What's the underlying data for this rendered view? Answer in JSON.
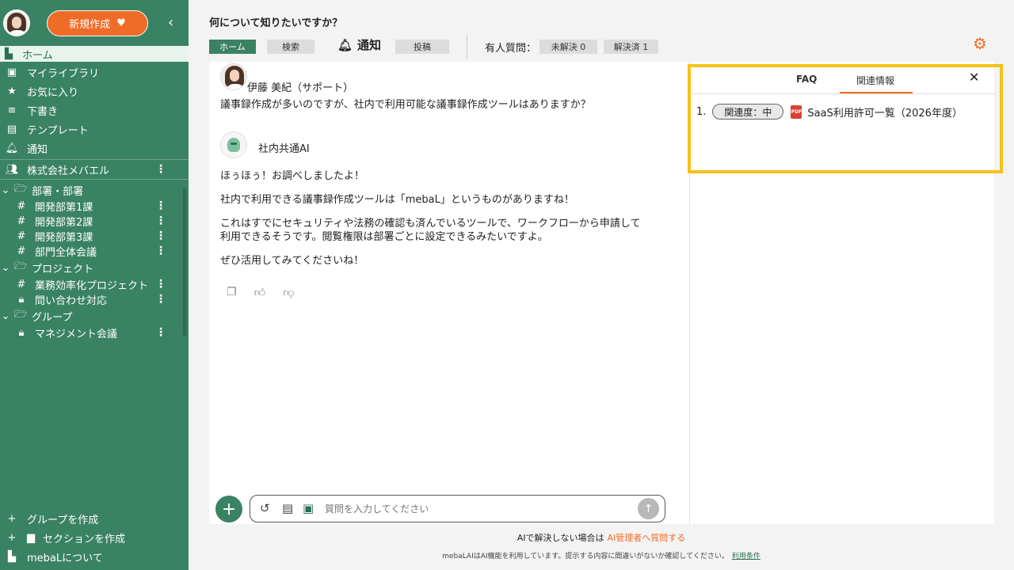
{
  "sidebar": {
    "new_button": "新規作成",
    "home": "ホーム",
    "items": [
      {
        "icon": "library-icon",
        "label": "マイライブラリ"
      },
      {
        "icon": "star-icon",
        "label": "お気に入り"
      },
      {
        "icon": "draft-icon",
        "label": "下書き"
      },
      {
        "icon": "template-icon",
        "label": "テンプレート"
      },
      {
        "icon": "bell-icon",
        "label": "通知"
      }
    ],
    "company": "株式会社メバエル",
    "sections": [
      {
        "label": "部署・部署",
        "children": [
          "開発部第1課",
          "開発部第2課",
          "開発部第3課",
          "部門全体会議"
        ]
      },
      {
        "label": "プロジェクト",
        "children": [
          "業務効率化プロジェクト",
          "問い合わせ対応"
        ]
      },
      {
        "label": "グループ",
        "children": [
          "マネジメント会議"
        ]
      }
    ],
    "bottom": {
      "create_group": "グループを作成",
      "create_section": "セクションを作成",
      "about": "mebaLについて"
    }
  },
  "header": {
    "title": "何について知りたいですか？",
    "tabs": {
      "home": "ホーム",
      "search": "検索",
      "notify": "通知",
      "post": "投稿"
    },
    "people_question": "有人質問：",
    "unresolved": "未解決 0",
    "resolved": "解決済 1"
  },
  "chat": {
    "user_name": "伊藤 美紀（サポート）",
    "question": "議事録作成が多いのですが、社内で利用可能な議事録作成ツールはありますか？",
    "ai_name": "社内共通AI",
    "answer": [
      "ほぅほぅ！お調べしましたよ！",
      "社内で利用できる議事録作成ツールは「mebaL」というものがありますね！",
      "これはすでにセキュリティや法務の確認も済んでいるツールで、ワークフローから申請して",
      "利用できるそうです。閲覧権限は部署ごとに設定できるみたいですよ。",
      "ぜひ活用してみてくださいね！"
    ],
    "input_placeholder": "質問を入力してください"
  },
  "right_panel": {
    "tab_faq": "FAQ",
    "tab_related": "関連情報",
    "related": [
      {
        "index": "1.",
        "badge": "関連度：中",
        "title": "SaaS利用許可一覧（2026年度）"
      }
    ]
  },
  "footer": {
    "line1": "AIで解決しない場合は",
    "line1_link": "AI管理者へ質問する",
    "line2": "mebaLAIはAI機能を利用しています。提示する内容に間違いがないか確認してください。",
    "line2_link": "利用条件"
  },
  "colors": {
    "brand": "#3a8264",
    "accent": "#ef6c28",
    "highlight": "#f5c216"
  }
}
